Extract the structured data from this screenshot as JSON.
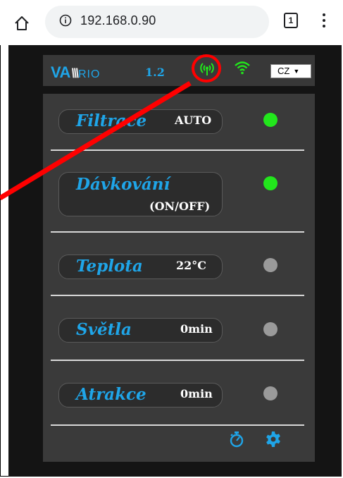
{
  "browser": {
    "url": "192.168.0.90",
    "tab_count": "1",
    "icons": [
      "home-icon",
      "info-icon",
      "tabs-icon",
      "menu-icon"
    ]
  },
  "header": {
    "logo_text_va": "VA",
    "logo_text_bars": "\\\\\\",
    "logo_text_rio": "RIO",
    "version": "1.2",
    "language": "CZ",
    "icons": [
      "antenna-icon",
      "wifi-icon"
    ]
  },
  "controls": [
    {
      "label": "Filtrace",
      "value": "AUTO",
      "status": "on"
    },
    {
      "label": "Dávkování",
      "value": "(ON/OFF)",
      "status": "on"
    },
    {
      "label": "Teplota",
      "value": "22°C",
      "status": "off"
    },
    {
      "label": "Světla",
      "value": "0min",
      "status": "off"
    },
    {
      "label": "Atrakce",
      "value": "0min",
      "status": "off"
    }
  ],
  "footer": {
    "icons": [
      "timer-icon",
      "gear-icon"
    ]
  },
  "colors": {
    "accent": "#1fa5e8",
    "led_on": "#22e61c",
    "led_off": "#9a9a9a",
    "annotation": "#ff0000"
  }
}
